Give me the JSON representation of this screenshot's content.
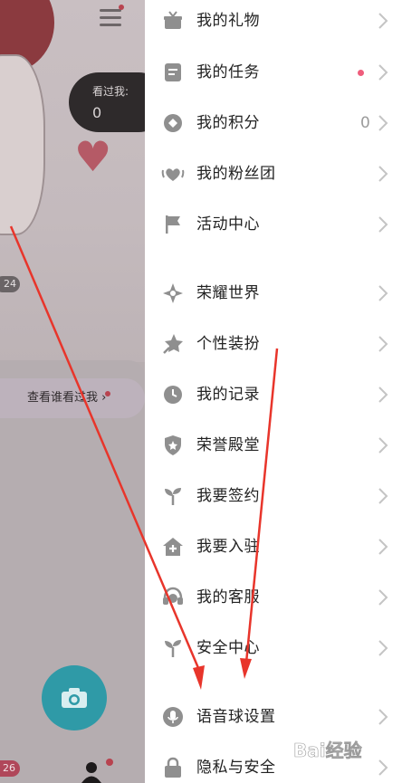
{
  "background": {
    "seen_label": "看过我:",
    "seen_count": "0",
    "age_badge": "24",
    "view_button": "查看谁看过我",
    "bottom_badge": "26"
  },
  "menu": {
    "items": [
      {
        "label": "我的礼物",
        "icon": "gift-icon",
        "top": 0
      },
      {
        "label": "我的任务",
        "icon": "task-icon",
        "has_dot": true
      },
      {
        "label": "我的积分",
        "icon": "points-icon",
        "count": "0"
      },
      {
        "label": "我的粉丝团",
        "icon": "fan-club-icon"
      },
      {
        "label": "活动中心",
        "icon": "flag-icon"
      },
      {
        "label": "荣耀世界",
        "icon": "glory-world-icon"
      },
      {
        "label": "个性装扮",
        "icon": "dress-up-icon"
      },
      {
        "label": "我的记录",
        "icon": "clock-icon"
      },
      {
        "label": "荣誉殿堂",
        "icon": "shield-icon"
      },
      {
        "label": "我要签约",
        "icon": "sprout-icon"
      },
      {
        "label": "我要入驻",
        "icon": "house-icon"
      },
      {
        "label": "我的客服",
        "icon": "headset-icon"
      },
      {
        "label": "安全中心",
        "icon": "sprout-icon"
      },
      {
        "label": "语音球设置",
        "icon": "microphone-icon"
      },
      {
        "label": "隐私与安全",
        "icon": "lock-icon"
      }
    ]
  },
  "colors": {
    "icon_gray": "#8f8f8f",
    "chevron": "#c4c4c4",
    "annotation_red": "#e8352b",
    "notify_dot": "#ef5d7c"
  },
  "watermark": {
    "text": "Bai经验"
  }
}
